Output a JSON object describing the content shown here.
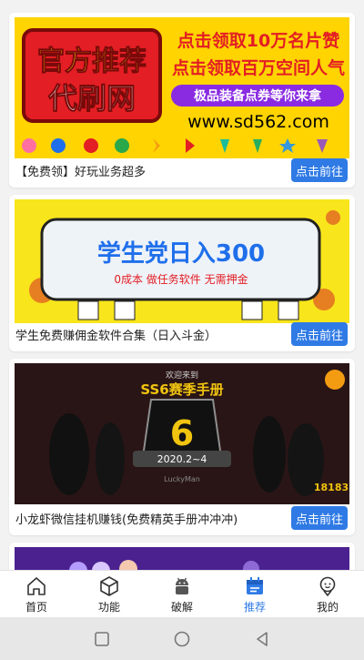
{
  "feed": {
    "cards": [
      {
        "banner": {
          "headline_1": "官方推荐",
          "headline_2": "代刷网",
          "tagline_1": "点击领取10万名片赞",
          "tagline_2": "点击领取百万空间人气",
          "tagline_3": "极品装备点券等你来拿",
          "url": "www.sd562.com"
        },
        "caption": "【免费领】好玩业务超多",
        "button": "点击前往"
      },
      {
        "banner": {
          "headline": "学生党日入300",
          "subline": "0成本 做任务软件 无需押金"
        },
        "caption": "学生免费赚佣金软件合集（日入斗金）",
        "button": "点击前往"
      },
      {
        "banner": {
          "welcome": "欢迎来到",
          "title": "SS6赛季手册",
          "number": "6",
          "date": "2020.2~4",
          "brand": "LuckyMan",
          "logo": "18183"
        },
        "caption": "小龙虾微信挂机赚钱(免费精英手册冲冲冲)",
        "button": "点击前往"
      }
    ]
  },
  "tabbar": {
    "items": [
      {
        "label": "首页",
        "icon": "home-icon"
      },
      {
        "label": "功能",
        "icon": "cube-icon"
      },
      {
        "label": "破解",
        "icon": "android-icon"
      },
      {
        "label": "推荐",
        "icon": "calendar-icon"
      },
      {
        "label": "我的",
        "icon": "profile-icon"
      }
    ],
    "active_index": 3
  },
  "colors": {
    "accent": "#2f7ae5",
    "banner1_bg": "#ffd400",
    "banner2_bg": "#f8e51c"
  }
}
